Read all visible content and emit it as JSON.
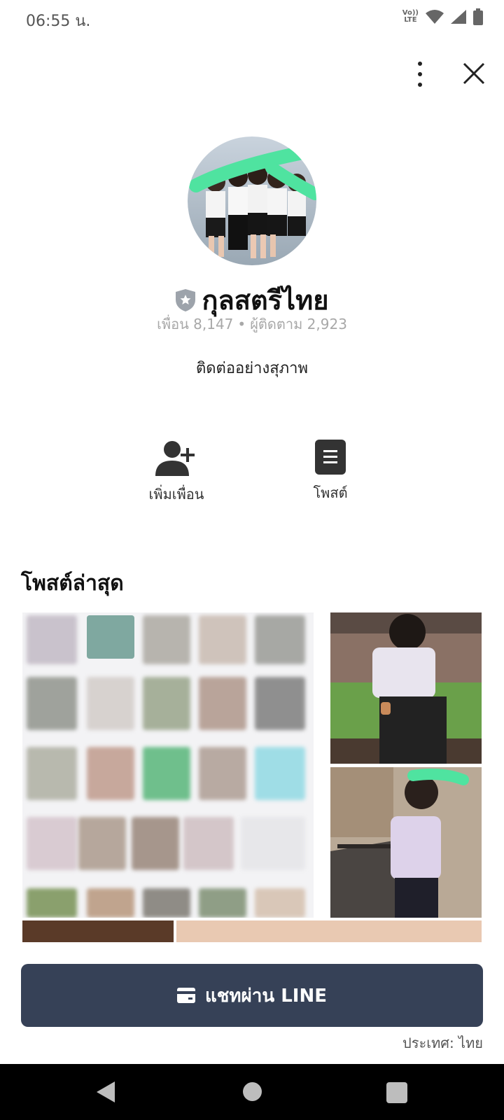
{
  "status_bar": {
    "time": "06:55 น.",
    "volte_line1": "Vo))",
    "volte_line2": "LTE",
    "icons": [
      "volte-icon",
      "wifi-icon",
      "signal-icon",
      "battery-icon"
    ]
  },
  "top_actions": {
    "icons": [
      "more-vert-icon",
      "close-icon"
    ]
  },
  "profile": {
    "name": "กุลสตรีไทย",
    "friends": "เพื่อน 8,147",
    "separator": "•",
    "followers": "ผู้ติดตาม 2,923",
    "status_message": "ติดต่ออย่างสุภาพ",
    "badge_icon": "verified-shield-icon"
  },
  "actions": {
    "add_friend": "เพิ่มเพื่อน",
    "posts": "โพสต์"
  },
  "latest_posts": {
    "title": "โพสต์ล่าสุด"
  },
  "chat_button": {
    "label": "แชทผ่าน LINE",
    "icon": "chat-card-icon"
  },
  "country": "ประเทศ: ไทย",
  "colors": {
    "chat_button_bg": "#364157",
    "highlight_scribble": "#4fe3a0"
  }
}
